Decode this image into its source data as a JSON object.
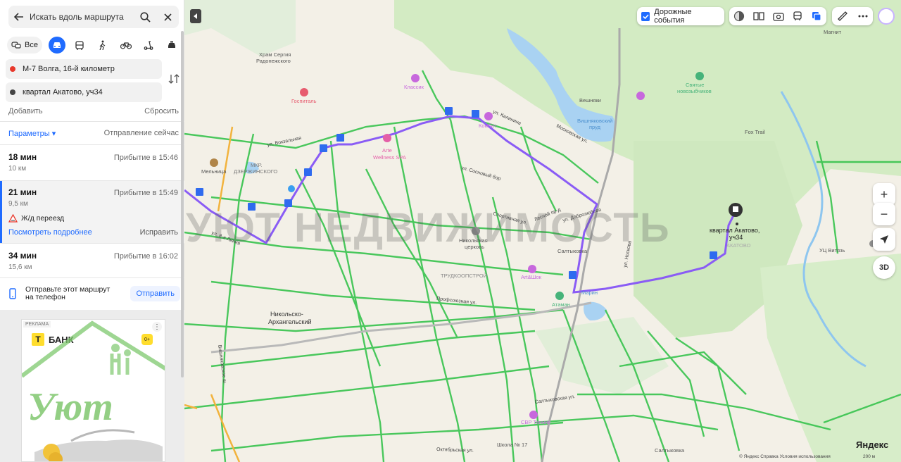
{
  "search": {
    "label": "Искать вдоль маршрута"
  },
  "modes": {
    "all_label": "Все"
  },
  "points": {
    "from": "М-7 Волга, 16-й километр",
    "to": "квартал Акатово, уч34",
    "add_label": "Добавить",
    "reset_label": "Сбросить"
  },
  "params": {
    "label": "Параметры ▾",
    "departure": "Отправление сейчас"
  },
  "routes": [
    {
      "time": "18 мин",
      "arrival": "Прибытие в 15:46",
      "distance": "10 км"
    },
    {
      "time": "21 мин",
      "arrival": "Прибытие в 15:49",
      "distance": "9,5 км",
      "warning": "Ж/д переезд",
      "details_label": "Посмотреть подробнее",
      "fix_label": "Исправить"
    },
    {
      "time": "34 мин",
      "arrival": "Прибытие в 16:02",
      "distance": "15,6 км"
    }
  ],
  "send": {
    "text": "Отправьте этот маршрут на телефон",
    "button": "Отправить"
  },
  "ad": {
    "tag": "РЕКЛАМА",
    "brand": "БАНК",
    "brand_letter": "Т",
    "age": "0+"
  },
  "map": {
    "traffic_label": "Дорожные события",
    "watermark": "УЮТ НЕДВИЖИМОСТЬ",
    "destination_label_1": "квартал Акатово,",
    "destination_label_2": "уч34",
    "labels": {
      "church_sergius_1": "Храм Сергия",
      "church_sergius_2": "Радонежского",
      "hospital": "Госпиталь",
      "classic": "Классик",
      "arte_1": "Arte",
      "arte_2": "Wellness SPA",
      "kombat": "Комбат",
      "veshnyaki_pond_1": "Вишняковский",
      "veshnyaki_pond_2": "пруд",
      "veshnyaki": "Вешняки",
      "holy_1": "Святые",
      "holy_2": "новозыбчиков",
      "fox_trail": "Fox Trail",
      "melnitsa": "Мельница",
      "mkr_1": "МКР.",
      "mkr_2": "ДЗЕРЖИНСКОГО",
      "nikol_church_1": "Никольская",
      "nikol_church_2": "церковь",
      "saltykovka": "Салтыковка",
      "trudkoopstroy": "ТРУДКООПСТРОЙ",
      "art_shok": "Art&Шок",
      "marin": "Марин",
      "ataman": "Атаман",
      "nikolsko_1": "Никольско-",
      "nikolsko_2": "Архангельский",
      "uts_vityaz": "УЦ Витязь",
      "akatovo": "АКАТОВО",
      "svr_tennis": "СВР Теннис",
      "school": "Школа № 17",
      "saltykovka2": "Салтыковка",
      "magnit": "Магнит",
      "street_vokzalnaya": "ул. Вокзальная",
      "street_dobrolyubova": "ул. Добролюбова",
      "street_sosnovyi": "ул. Сосновый бор",
      "street_noskova": "ул. Носкова",
      "street_kalinina": "ул. Калинина",
      "street_lesnoi": "Лесной пр-д",
      "street_sportivnaya": "Спортивная ул.",
      "street_profsoyuznaya": "Профсоюзная ул.",
      "street_8liniya": "ул. 8-я Линия",
      "street_oktyabrskaya": "Октябрьская ул.",
      "street_saltykovskaya": "Салтыковская ул.",
      "street_vishnyakovskoe": "Вишняковское ш.",
      "street_moskovskaya": "Московская ул."
    },
    "copyright": "© Яндекс   Справка   Условия использования",
    "logo": "Яндекс",
    "scale": "200 м"
  },
  "colors": {
    "route": "#8a5cf5",
    "accent": "#1f6bff",
    "traffic_green": "#37c34d"
  },
  "icons": [
    "arrow-left-icon",
    "search-icon",
    "close-icon",
    "car-icon",
    "bus-icon",
    "walk-icon",
    "bike-icon",
    "scooter-icon",
    "taxi-icon",
    "swap-icon",
    "warning-icon",
    "phone-icon",
    "zoom-in-icon",
    "zoom-out-icon",
    "locate-icon",
    "3d-icon"
  ]
}
